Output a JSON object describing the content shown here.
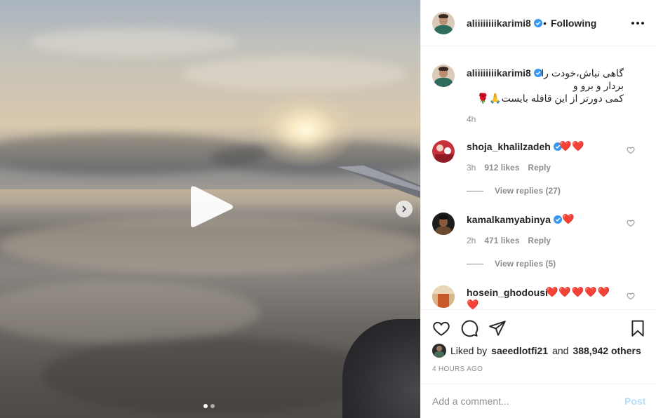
{
  "post": {
    "author": "aliiiiiiiikarimi8",
    "follow_separator": "•",
    "follow_status": "Following",
    "caption_lines": [
      "گاهی نباش،خودت را",
      "بردار و برو و",
      "کمی دورتر از این قافله بایست🙏🌹"
    ],
    "caption_time": "4h"
  },
  "media": {
    "slide_count": 2,
    "active_slide": 1,
    "type": "video"
  },
  "comments": [
    {
      "user": "shoja_khalilzadeh",
      "verified": true,
      "text": "❤️❤️",
      "time": "3h",
      "likes": "912 likes",
      "reply": "Reply",
      "view_replies": "View replies (27)"
    },
    {
      "user": "kamalkamyabinya",
      "verified": true,
      "text": "❤️",
      "time": "2h",
      "likes": "471 likes",
      "reply": "Reply",
      "view_replies": "View replies (5)"
    },
    {
      "user": "hosein_ghodousi",
      "verified": false,
      "text": "❤️❤️❤️❤️❤️",
      "text_overflow": "❤️"
    }
  ],
  "engagement": {
    "liked_by_prefix": "Liked by",
    "liked_by_user": "saeedlotfi21",
    "liked_by_middle": "and",
    "liked_by_count": "388,942 others",
    "post_time": "4 HOURS AGO"
  },
  "composer": {
    "placeholder": "Add a comment...",
    "post_label": "Post"
  },
  "colors": {
    "verified": "#3897f0",
    "heart": "#e0245e",
    "post_disabled": "#b2dffc",
    "muted": "#8e8e8e"
  }
}
